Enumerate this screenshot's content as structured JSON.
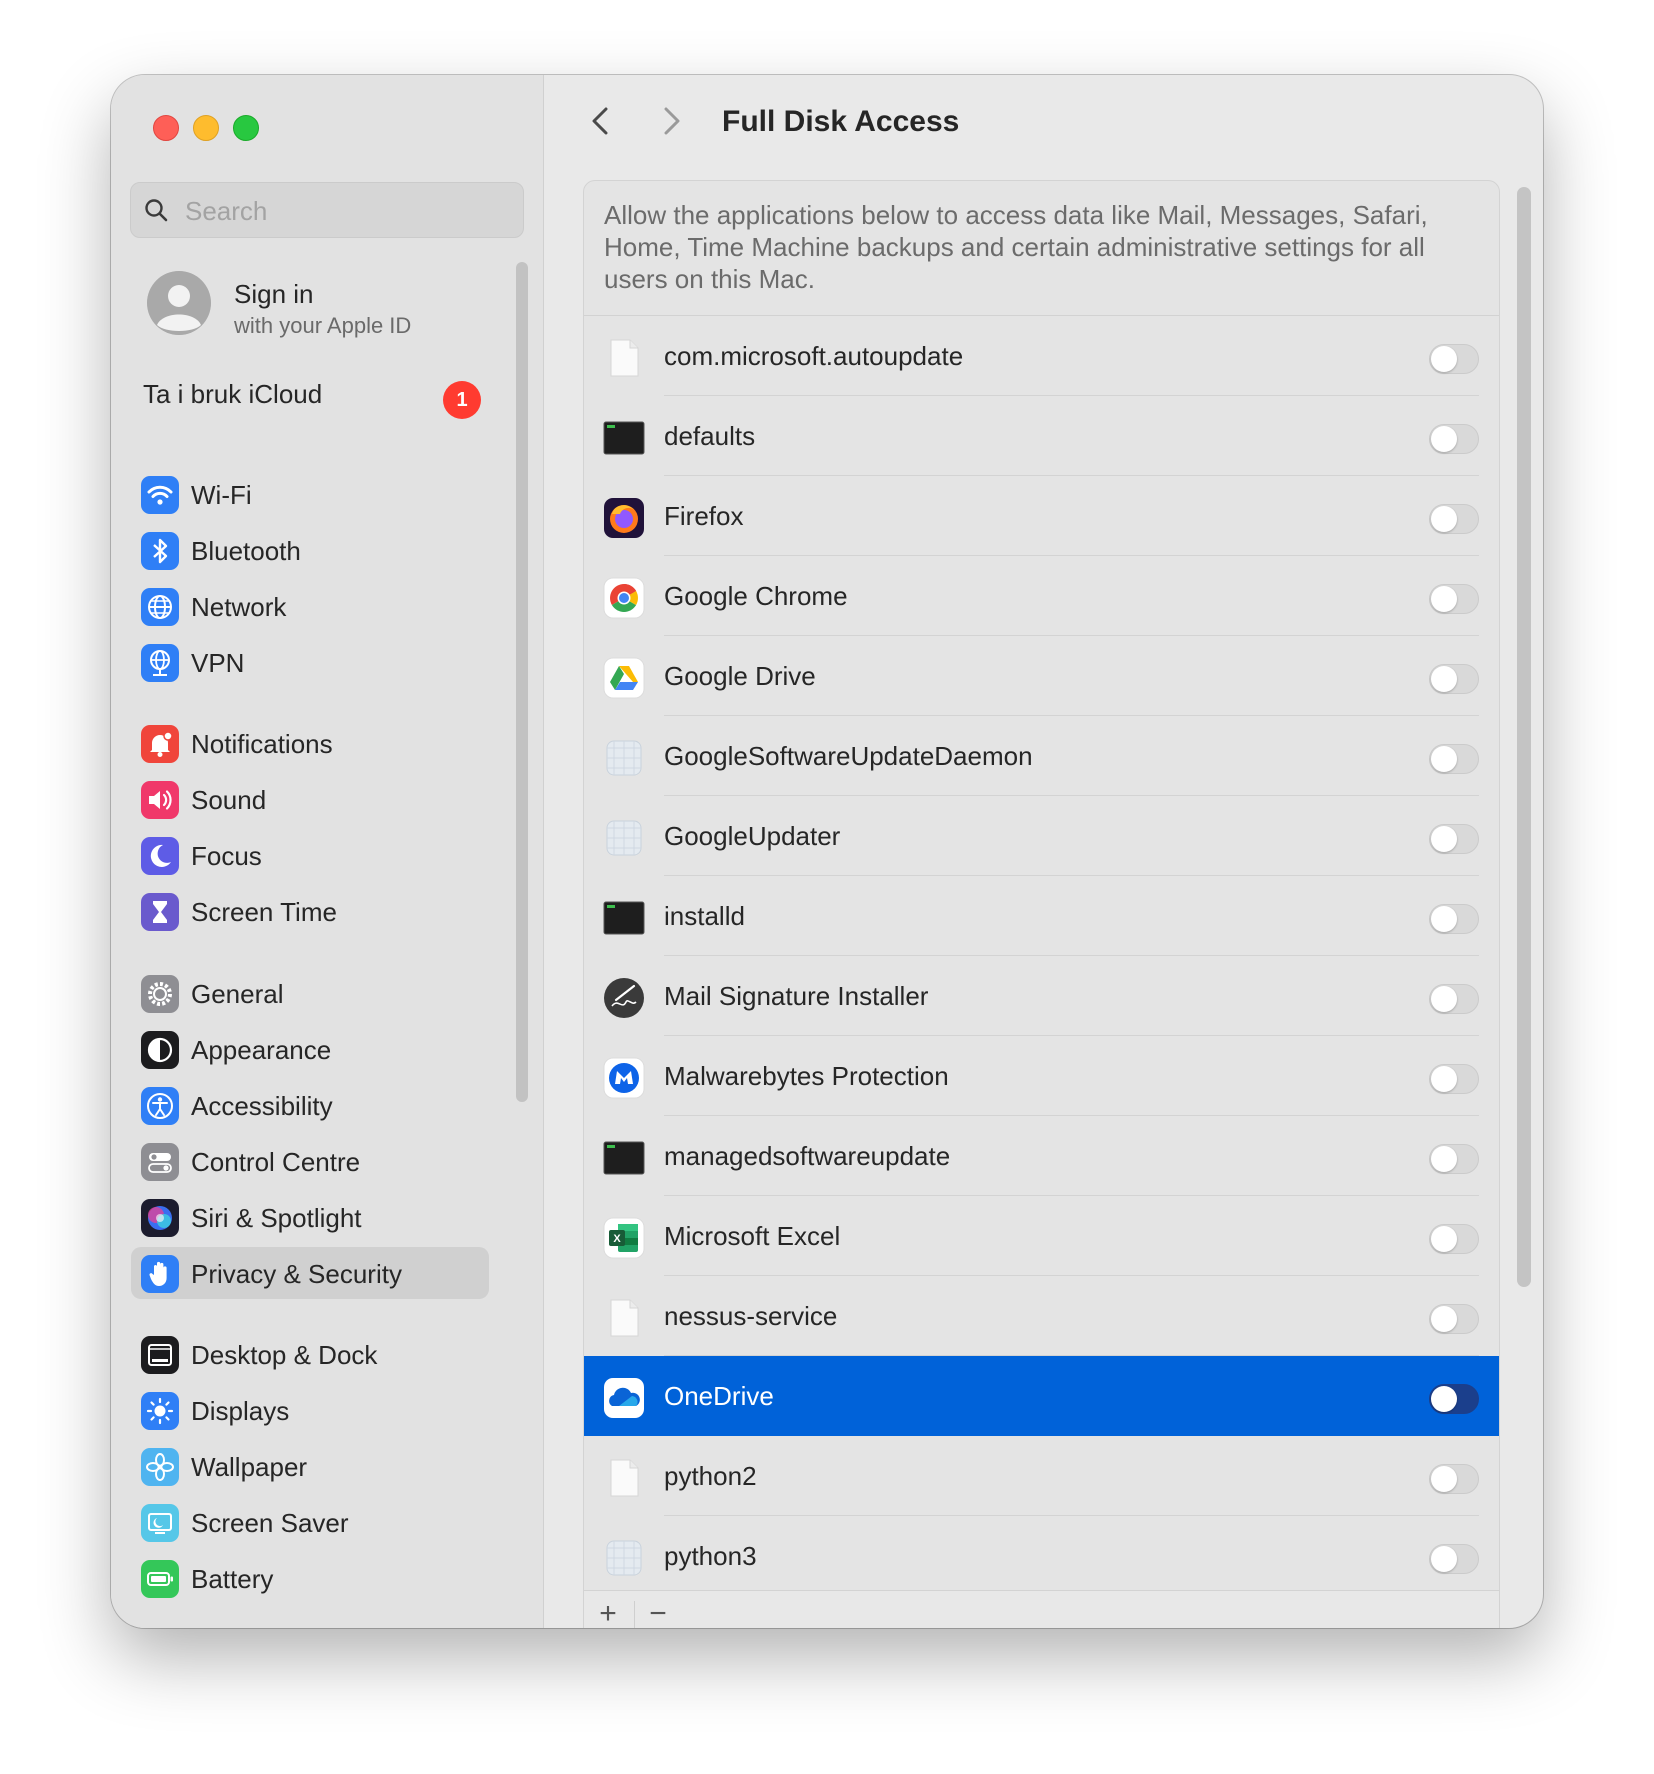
{
  "window": {
    "title": "Full Disk Access"
  },
  "search": {
    "placeholder": "Search"
  },
  "account": {
    "title": "Sign in",
    "subtitle": "with your Apple ID"
  },
  "icloud": {
    "label": "Ta i bruk iCloud",
    "badge": "1"
  },
  "sidebar": {
    "items": [
      {
        "label": "Wi-Fi",
        "icon": "wifi-icon",
        "color": "#2f7ff6"
      },
      {
        "label": "Bluetooth",
        "icon": "bluetooth-icon",
        "color": "#2f7ff6"
      },
      {
        "label": "Network",
        "icon": "globe-icon",
        "color": "#2f7ff6"
      },
      {
        "label": "VPN",
        "icon": "vpn-globe-icon",
        "color": "#2f7ff6"
      },
      {
        "label": "Notifications",
        "icon": "bell-icon",
        "color": "#f0453b"
      },
      {
        "label": "Sound",
        "icon": "speaker-icon",
        "color": "#f0386a"
      },
      {
        "label": "Focus",
        "icon": "moon-icon",
        "color": "#5e5ce6"
      },
      {
        "label": "Screen Time",
        "icon": "hourglass-icon",
        "color": "#6a5acd"
      },
      {
        "label": "General",
        "icon": "gear-icon",
        "color": "#8e8e93"
      },
      {
        "label": "Appearance",
        "icon": "appearance-icon",
        "color": "#1c1c1e"
      },
      {
        "label": "Accessibility",
        "icon": "accessibility-icon",
        "color": "#2f7ff6"
      },
      {
        "label": "Control Centre",
        "icon": "toggles-icon",
        "color": "#8e8e93"
      },
      {
        "label": "Siri & Spotlight",
        "icon": "siri-icon",
        "color": "#1c1c2e"
      },
      {
        "label": "Privacy & Security",
        "icon": "hand-icon",
        "color": "#2f7ff6"
      },
      {
        "label": "Desktop & Dock",
        "icon": "dock-icon",
        "color": "#1c1c1e"
      },
      {
        "label": "Displays",
        "icon": "sun-icon",
        "color": "#2f7ff6"
      },
      {
        "label": "Wallpaper",
        "icon": "flower-icon",
        "color": "#4fb4f0"
      },
      {
        "label": "Screen Saver",
        "icon": "screensaver-icon",
        "color": "#56c7e8"
      },
      {
        "label": "Battery",
        "icon": "battery-icon",
        "color": "#34c759"
      }
    ],
    "selected": "Privacy & Security"
  },
  "main": {
    "description": "Allow the applications below to access data like Mail, Messages, Safari, Home, Time Machine backups and certain administrative settings for all users on this Mac.",
    "apps": [
      {
        "name": "com.microsoft.autoupdate",
        "icon": "blank-document-icon",
        "enabled": false
      },
      {
        "name": "defaults",
        "icon": "terminal-exec-icon",
        "enabled": false
      },
      {
        "name": "Firefox",
        "icon": "firefox-icon",
        "enabled": false
      },
      {
        "name": "Google Chrome",
        "icon": "chrome-icon",
        "enabled": false
      },
      {
        "name": "Google Drive",
        "icon": "google-drive-icon",
        "enabled": false
      },
      {
        "name": "GoogleSoftwareUpdateDaemon",
        "icon": "generic-app-icon",
        "enabled": false
      },
      {
        "name": "GoogleUpdater",
        "icon": "generic-app-icon",
        "enabled": false
      },
      {
        "name": "installd",
        "icon": "terminal-exec-icon",
        "enabled": false
      },
      {
        "name": "Mail Signature Installer",
        "icon": "signature-pen-icon",
        "enabled": false
      },
      {
        "name": "Malwarebytes Protection",
        "icon": "malwarebytes-icon",
        "enabled": false
      },
      {
        "name": "managedsoftwareupdate",
        "icon": "terminal-exec-icon",
        "enabled": false
      },
      {
        "name": "Microsoft Excel",
        "icon": "excel-icon",
        "enabled": false
      },
      {
        "name": "nessus-service",
        "icon": "blank-document-icon",
        "enabled": false
      },
      {
        "name": "OneDrive",
        "icon": "onedrive-icon",
        "enabled": false
      },
      {
        "name": "python2",
        "icon": "blank-document-icon",
        "enabled": false
      },
      {
        "name": "python3",
        "icon": "generic-app-icon",
        "enabled": false
      }
    ],
    "selected_app": "OneDrive",
    "add_label": "+",
    "remove_label": "−"
  },
  "colors": {
    "selection": "#0062d9",
    "badge": "#ff3b30"
  }
}
